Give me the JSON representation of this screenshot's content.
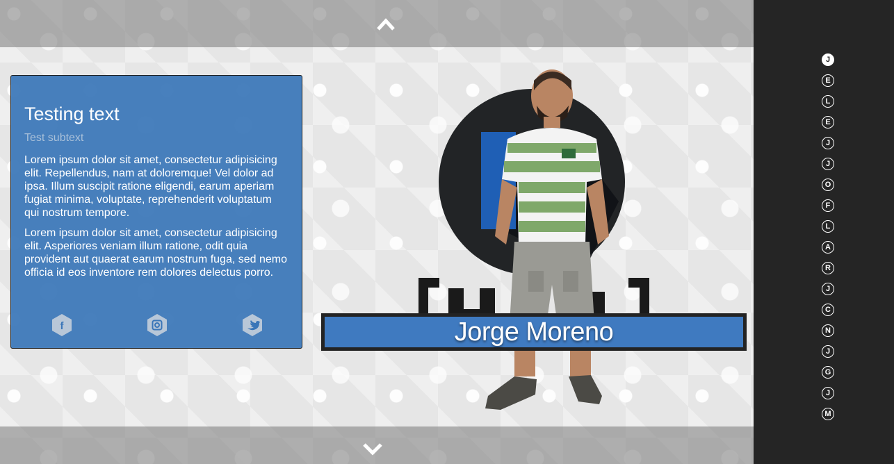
{
  "navigation": {
    "up_icon": "chevron-up-icon",
    "down_icon": "chevron-down-icon"
  },
  "card": {
    "title": "Testing text",
    "subtitle": "Test subtext",
    "paragraphs": [
      "Lorem ipsum dolor sit amet, consectetur adipisicing elit. Repellendus, nam at doloremque! Vel dolor ad ipsa. Illum suscipit ratione eligendi, earum aperiam fugiat minima, voluptate, reprehenderit voluptatum qui nostrum tempore.",
      "Lorem ipsum dolor sit amet, consectetur adipisicing elit. Asperiores veniam illum ratione, odit quia provident aut quaerat earum nostrum fuga, sed nemo officia id eos inventore rem dolores delectus porro."
    ],
    "socials": [
      {
        "name": "facebook",
        "glyph": "f",
        "icon": "facebook-icon"
      },
      {
        "name": "instagram",
        "glyph": "",
        "icon": "instagram-icon"
      },
      {
        "name": "twitter",
        "glyph": "",
        "icon": "twitter-icon"
      }
    ],
    "accent_color": "#3a76b8"
  },
  "profile": {
    "name": "Jorge Moreno"
  },
  "sidebar": {
    "letters": [
      "J",
      "E",
      "L",
      "E",
      "J",
      "J",
      "O",
      "F",
      "L",
      "A",
      "R",
      "J",
      "C",
      "N",
      "J",
      "G",
      "J",
      "M"
    ],
    "active_index": 0
  },
  "colors": {
    "sidebar_bg": "#252525",
    "nameplate_blue": "#3f7ac0"
  }
}
